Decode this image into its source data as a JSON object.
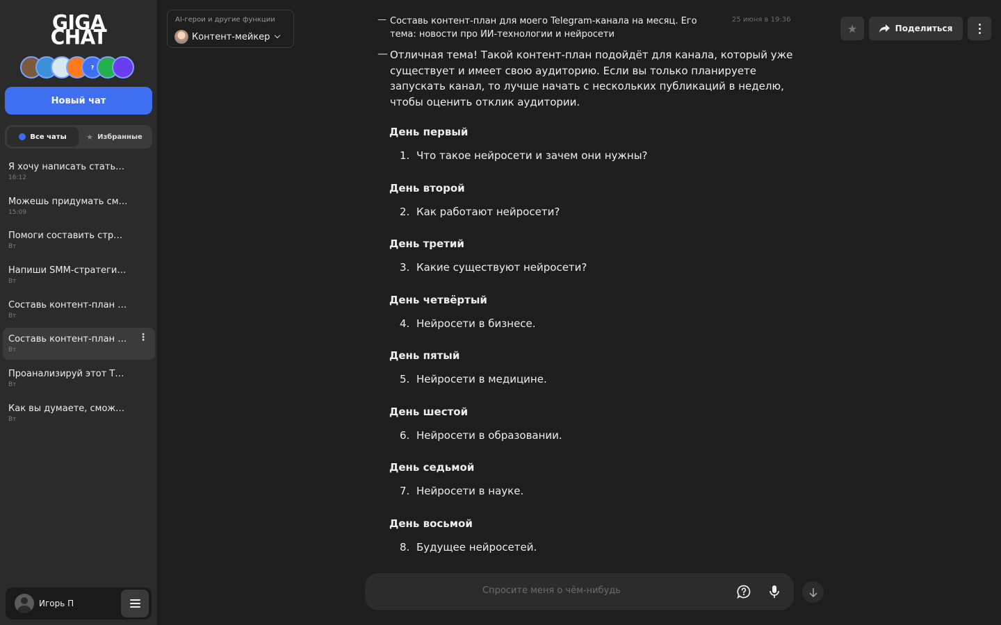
{
  "sidebar": {
    "logo_line1": "GIGA",
    "logo_line2": "CHAT",
    "new_chat_label": "Новый чат",
    "filter_all": "Все чаты",
    "filter_fav": "Избранные",
    "chats": [
      {
        "title": "Я хочу написать стать…",
        "time": "16:12"
      },
      {
        "title": "Можешь придумать см…",
        "time": "15:09"
      },
      {
        "title": "Помоги составить стра…",
        "time": "Вт"
      },
      {
        "title": "Напиши SMM-стратеги…",
        "time": "Вт"
      },
      {
        "title": "Составь контент-план …",
        "time": "Вт"
      },
      {
        "title": "Составь контент-план …",
        "time": "Вт"
      },
      {
        "title": "Проанализируй этот Т…",
        "time": "Вт"
      },
      {
        "title": "Как вы думаете, сможе…",
        "time": "Вт"
      }
    ],
    "user_name": "Игорь П"
  },
  "agent": {
    "caption": "AI-герои и другие функции",
    "name": "Контент-мейкер"
  },
  "actions": {
    "share_label": "Поделиться"
  },
  "conversation": {
    "user_message": "Составь контент-план для моего Telegram-канала на месяц. Его тема: новости про ИИ-технологии и нейросети",
    "user_time": "25 июня в 19:36",
    "bot_intro": "Отличная тема! Такой контент-план подойдёт для канала, который уже существует и имеет свою аудиторию. Если вы только планируете запускать канал, то лучше начать с нескольких публикаций в неделю, чтобы оценить отклик аудитории.",
    "days": [
      {
        "title": "День первый",
        "num": "1.",
        "item": "Что такое нейросети и зачем они нужны?"
      },
      {
        "title": "День второй",
        "num": "2.",
        "item": "Как работают нейросети?"
      },
      {
        "title": "День третий",
        "num": "3.",
        "item": "Какие существуют нейросети?"
      },
      {
        "title": "День четвёртый",
        "num": "4.",
        "item": "Нейросети в бизнесе."
      },
      {
        "title": "День пятый",
        "num": "5.",
        "item": "Нейросети в медицине."
      },
      {
        "title": "День шестой",
        "num": "6.",
        "item": "Нейросети в образовании."
      },
      {
        "title": "День седьмой",
        "num": "7.",
        "item": "Нейросети в науке."
      },
      {
        "title": "День восьмой",
        "num": "8.",
        "item": "Будущее нейросетей."
      }
    ]
  },
  "input": {
    "placeholder": "Спросите меня о чём-нибудь"
  }
}
